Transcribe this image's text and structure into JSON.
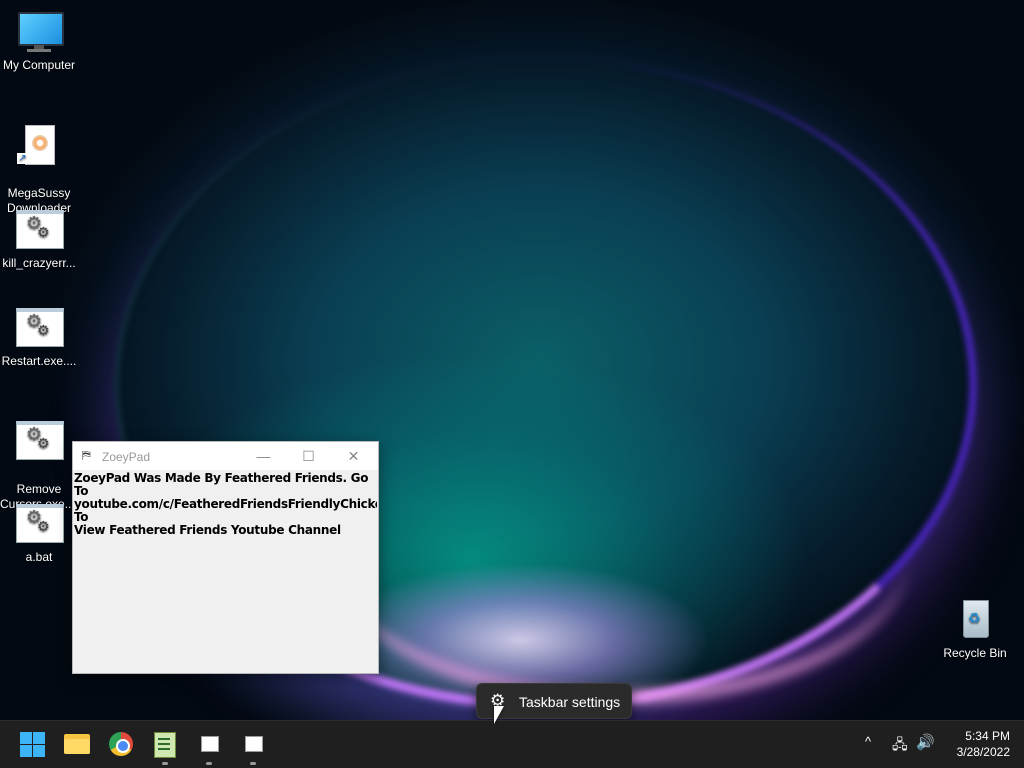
{
  "desktop": {
    "icons": [
      {
        "label": "My Computer",
        "icon": "monitor-icon"
      },
      {
        "label": "MegaSussy\nDownloader",
        "icon": "shortcut-document-icon"
      },
      {
        "label": "kill_crazyerr...",
        "icon": "executable-icon"
      },
      {
        "label": "Restart.exe....",
        "icon": "executable-icon"
      },
      {
        "label": "Remove\nCursors.exe....",
        "icon": "executable-icon"
      },
      {
        "label": "a.bat",
        "icon": "executable-icon"
      },
      {
        "label": "Recycle Bin",
        "icon": "recycle-bin-icon"
      }
    ]
  },
  "window": {
    "title": "ZoeyPad",
    "icon": "zoeypad-app-icon",
    "content": "ZoeyPad Was Made By Feathered Friends. Go To\nyoutube.com/c/FeatheredFriendsFriendlyChickens To\nView Feathered Friends Youtube Channel",
    "controls": {
      "minimize": "—",
      "maximize": "☐",
      "close": "✕"
    }
  },
  "context_menu": {
    "items": [
      {
        "label": "Taskbar settings",
        "icon": "gear-icon"
      }
    ]
  },
  "taskbar": {
    "apps": [
      {
        "name": "start",
        "icon": "windows-logo-icon"
      },
      {
        "name": "file-explorer",
        "icon": "folder-icon"
      },
      {
        "name": "chrome",
        "icon": "chrome-icon"
      },
      {
        "name": "notepad",
        "icon": "notepad-icon"
      },
      {
        "name": "app",
        "icon": "app-window-icon"
      },
      {
        "name": "app",
        "icon": "app-window-icon"
      }
    ],
    "tray": {
      "chevron": "^",
      "time": "5:34 PM",
      "date": "3/28/2022"
    }
  },
  "colors": {
    "taskbar_bg": "#1f1f1f",
    "accent": "#3cb4f5",
    "context_menu_bg": "#2b2b2b"
  }
}
